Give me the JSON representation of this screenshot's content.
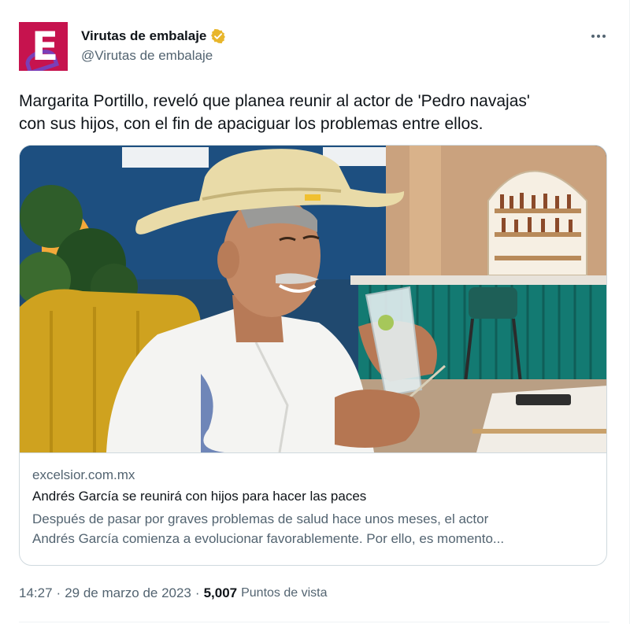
{
  "author": {
    "display_name": "Virutas de embalaje",
    "handle": "@Virutas de embalaje",
    "avatar_letter": "E",
    "verified_color": "#e8b62b",
    "brand_color": "#c6134e"
  },
  "menu": {
    "icon": "more-horizontal-icon"
  },
  "tweet": {
    "text_line1": "Margarita Portillo, reveló que planea reunir al actor de 'Pedro navajas'",
    "text_line2": "con sus hijos, con el fin de apaciguar los problemas entre ellos."
  },
  "card": {
    "domain": "excelsior.com.mx",
    "title": "Andrés García se reunirá con hijos para hacer las paces",
    "description_line1": "Después de pasar por graves problemas de salud hace unos meses, el actor",
    "description_line2": "Andrés García comienza a evolucionar favorablemente. Por ello, es momento..."
  },
  "meta": {
    "time": "14:27",
    "dot1": "·",
    "date": "29 de marzo de 2023",
    "dot2": "·",
    "views_count": "5,007",
    "views_label": "Puntos de vista"
  }
}
